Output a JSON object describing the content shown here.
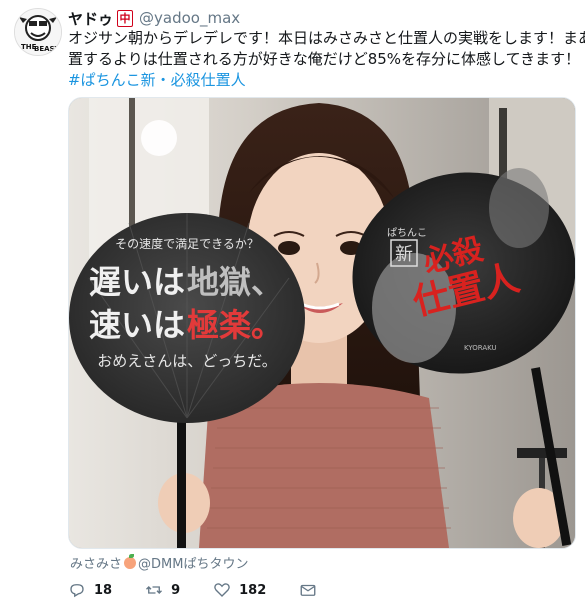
{
  "tweet": {
    "display_name": "ヤドゥ",
    "name_emoji": "中",
    "handle": "@yadoo_max",
    "text_lines": [
      "オジサン朝からデレデレです！本日はみさみさと仕置人の実戦をします！まあ仕",
      "置するよりは仕置される方が好きな俺だけど85%を存分に体感してきます！"
    ],
    "hashtag": "#ぱちんこ新・必殺仕置人",
    "credit_prefix": "みさみさ",
    "credit_suffix": "@DMMぱちタウン"
  },
  "avatar": {
    "text_1": "THE",
    "text_2": "BEAST"
  },
  "media": {
    "fan_left": {
      "top": "その速度で満足できるか？",
      "line1a": "遅いは",
      "line1b": "地獄、",
      "line2a": "速いは",
      "line2b": "極楽。",
      "bottom": "おめえさんは、どっちだ。"
    },
    "fan_right": {
      "small": "ぱちんこ",
      "box": "新",
      "title1": "必殺",
      "title2": "仕置人",
      "brand": "KYORAKU"
    }
  },
  "actions": {
    "reply_count": "18",
    "retweet_count": "9",
    "like_count": "182"
  },
  "colors": {
    "link": "#1b95e0",
    "muted": "#657786",
    "text": "#14171a"
  }
}
